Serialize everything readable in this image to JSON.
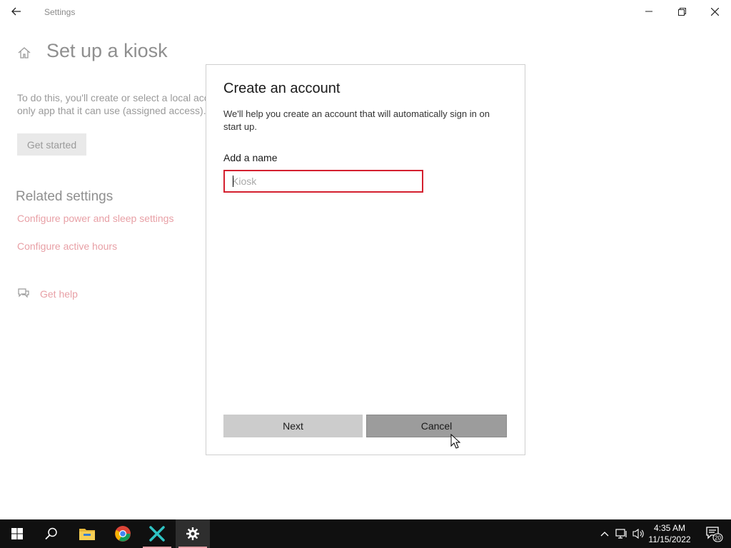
{
  "window": {
    "title": "Settings",
    "controls": {
      "minimize": "minimize",
      "maximize": "restore",
      "close": "close"
    }
  },
  "page": {
    "title": "Set up a kiosk",
    "description_line1": "To do this, you'll create or select a local account and choose the",
    "description_line2": "only app that it can use (assigned access).",
    "get_started": "Get started",
    "related_title": "Related settings",
    "related_links": [
      {
        "label": "Configure power and sleep settings"
      },
      {
        "label": "Configure active hours"
      }
    ],
    "help_label": "Get help"
  },
  "dialog": {
    "title": "Create an account",
    "description": "We'll help you create an account that will automatically sign in on start up.",
    "field_label": "Add a name",
    "input_placeholder": "Kiosk",
    "input_value": "",
    "next_label": "Next",
    "cancel_label": "Cancel"
  },
  "taskbar": {
    "apps": [
      {
        "icon": "windows-start-icon"
      },
      {
        "icon": "search-icon"
      },
      {
        "icon": "file-explorer-icon"
      },
      {
        "icon": "chrome-icon"
      },
      {
        "icon": "x-app-icon"
      },
      {
        "icon": "settings-gear-icon"
      }
    ],
    "clock": {
      "time": "4:35 AM",
      "date": "11/15/2022"
    },
    "notifications": {
      "count": "20"
    }
  },
  "colors": {
    "accent_link": "#e8a0a6",
    "input_border_error": "#d4202f",
    "taskbar_bg": "#101010"
  }
}
